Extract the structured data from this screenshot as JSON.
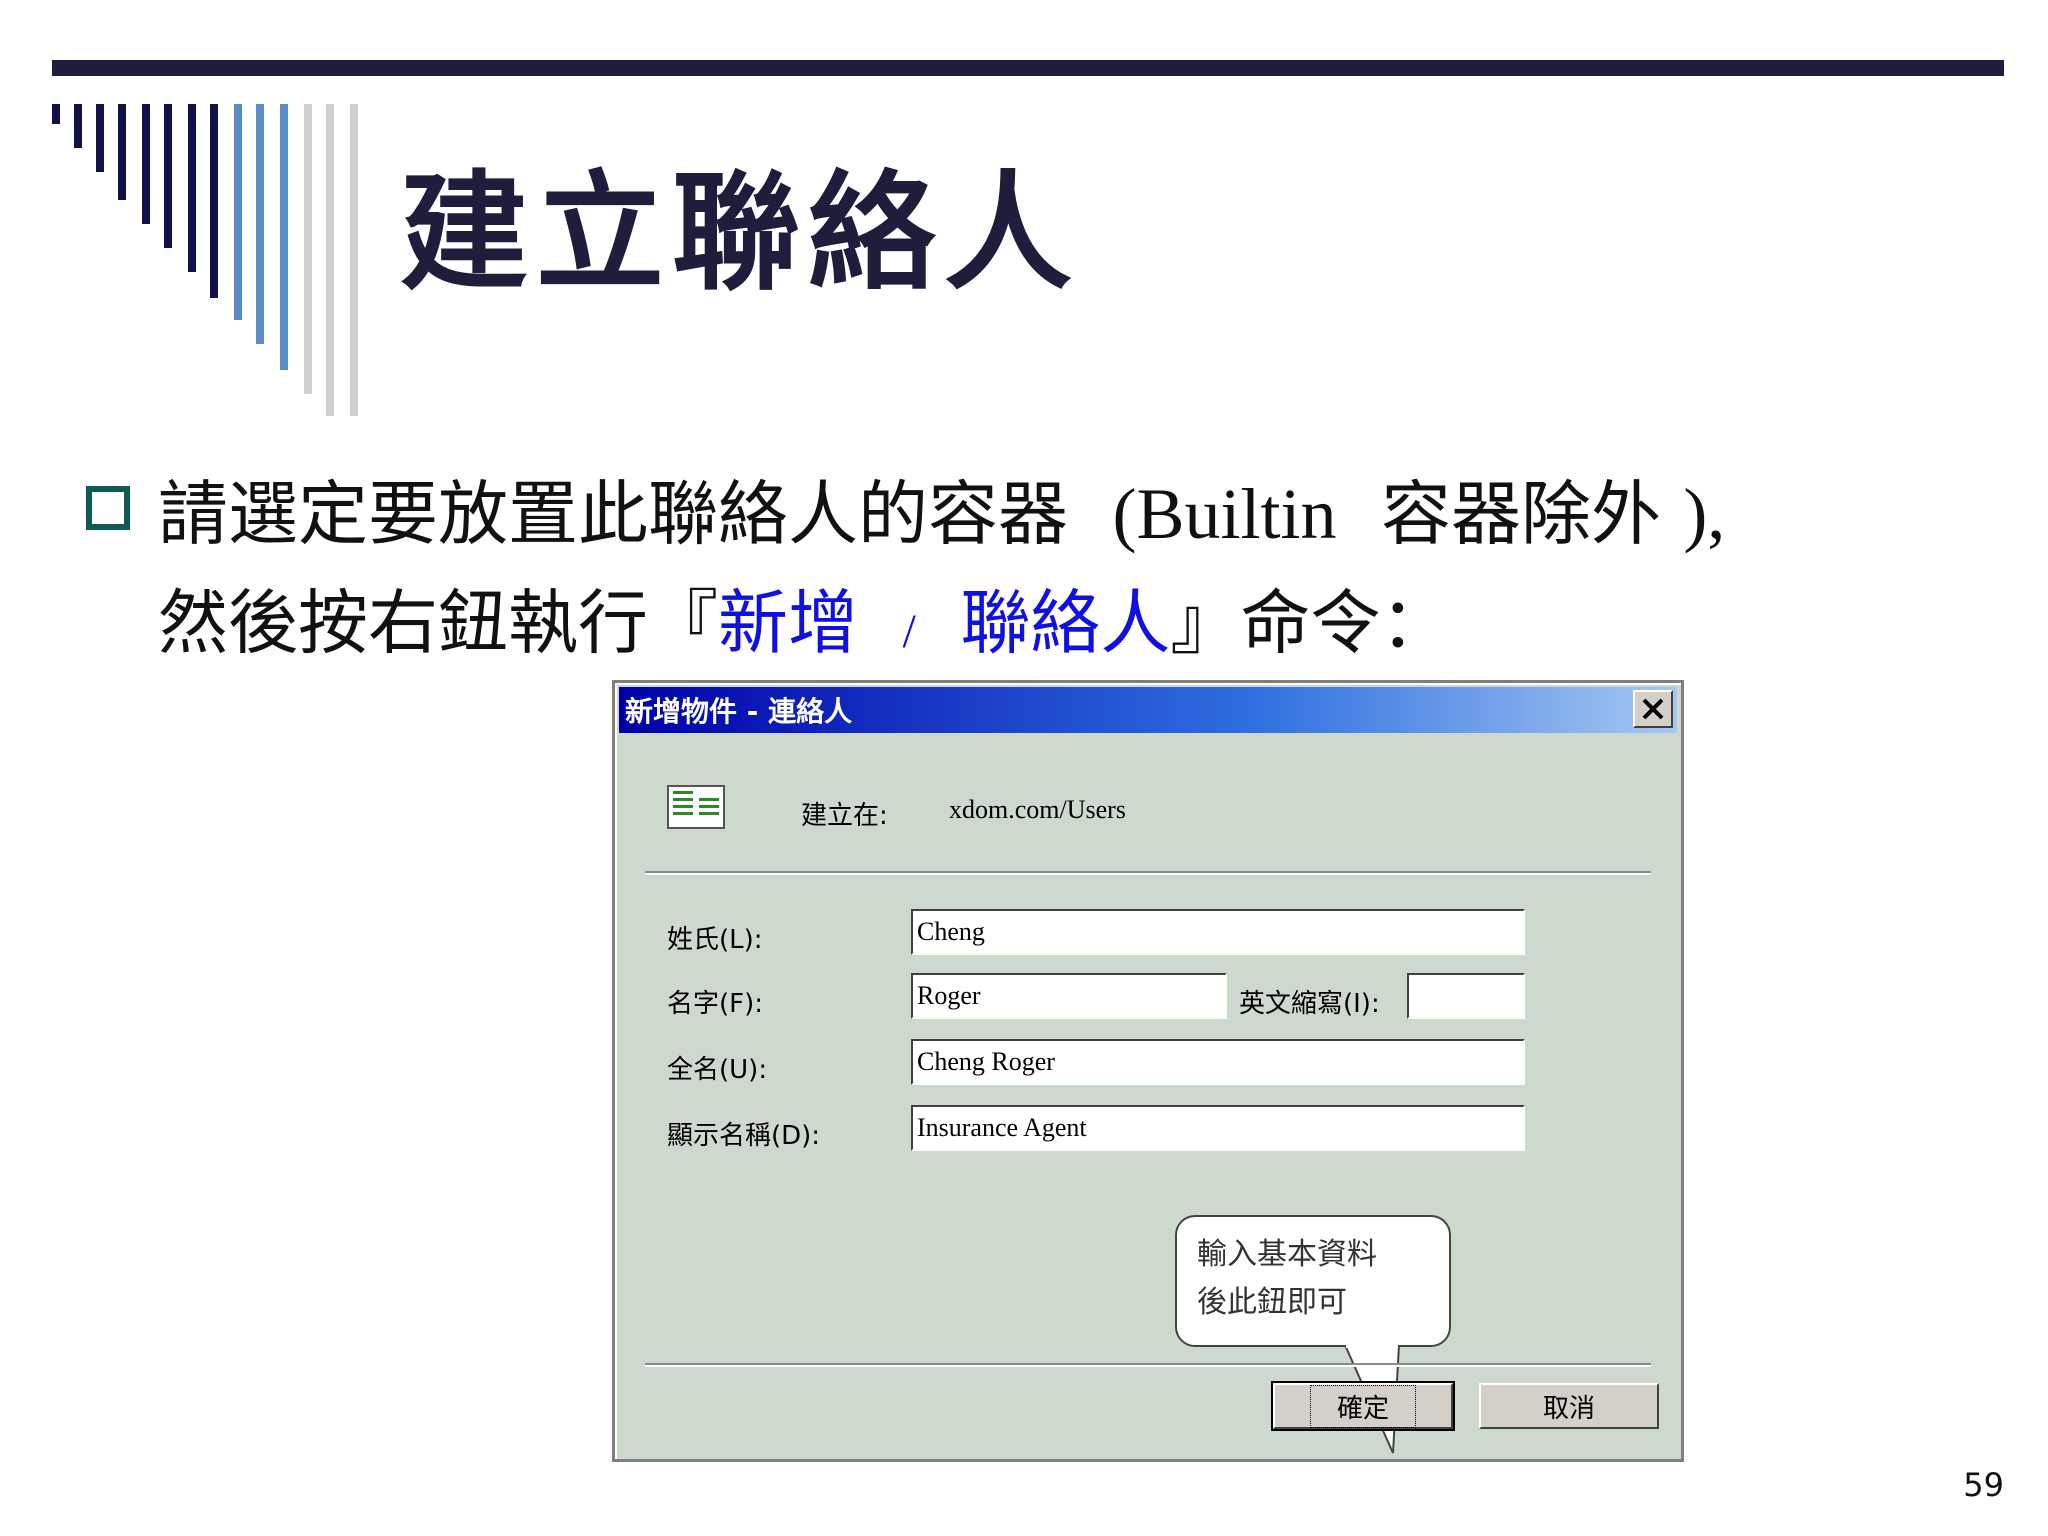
{
  "slide": {
    "title": "建立聯絡人",
    "bullet_line1_a": "請選定要放置此聯絡人的容器",
    "bullet_line1_b": "(Builtin",
    "bullet_line1_c": "容器除外",
    "bullet_line1_d": "),",
    "bullet_line2_a": "然後按右鈕執行『",
    "bullet_line2_b": "新增",
    "bullet_line2_sep": "/",
    "bullet_line2_c": "聯絡人",
    "bullet_line2_d": "』命令：",
    "page_number": "59"
  },
  "dialog": {
    "title": "新增物件 - 連絡人",
    "create_in_label": "建立在:",
    "create_in_value": "xdom.com/Users",
    "fields": {
      "last_name_label": "姓氏(L):",
      "last_name_value": "Cheng",
      "first_name_label": "名字(F):",
      "first_name_value": "Roger",
      "initials_label": "英文縮寫(I):",
      "initials_value": "",
      "full_name_label": "全名(U):",
      "full_name_value": "Cheng Roger",
      "display_name_label": "顯示名稱(D):",
      "display_name_value": "Insurance Agent"
    },
    "callout_line1": "輸入基本資料",
    "callout_line2": "後此鈕即可",
    "ok_label": "確定",
    "cancel_label": "取消"
  },
  "colors": {
    "title": "#1e1e3c",
    "bullet_box": "#0f5a55",
    "highlight": "#1010e0",
    "dialog_bg": "#cdd9cc",
    "titlebar_start": "#0000a8"
  },
  "icons": {
    "close": "close-icon",
    "contact": "contact-card-icon",
    "bullet": "square-bullet-icon"
  }
}
